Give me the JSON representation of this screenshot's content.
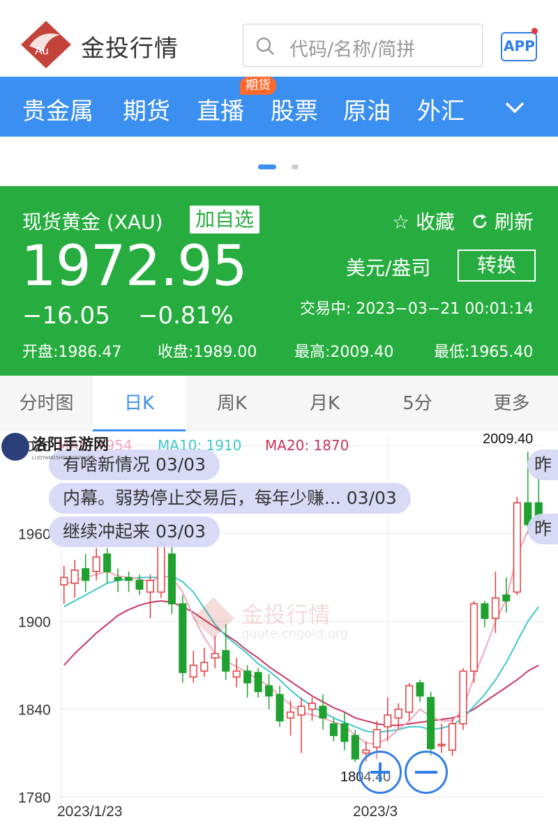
{
  "header": {
    "brand": "金投行情",
    "logo_text": "Au",
    "search_placeholder": "代码/名称/简拼",
    "app_label": "APP"
  },
  "nav": {
    "items": [
      "贵金属",
      "期货",
      "直播",
      "股票",
      "原油",
      "外汇"
    ],
    "badge": "期货"
  },
  "quote": {
    "name": "现货黄金 (XAU)",
    "add_label": "加自选",
    "fav_label": "☆ 收藏",
    "refresh_label": "刷新",
    "price": "1972.95",
    "unit": "美元/盎司",
    "convert_label": "转换",
    "change": "−16.05",
    "change_pct": "−0.81%",
    "status_time": "交易中:  2023−03−21 00:01:14",
    "open": "开盘:1986.47",
    "prev_close": "收盘:1989.00",
    "high": "最高:2009.40",
    "low": "最低:1965.40",
    "color": "#27ad3f"
  },
  "tabs": [
    {
      "label": "分时图",
      "active": false
    },
    {
      "label": "日K",
      "active": true
    },
    {
      "label": "周K",
      "active": false
    },
    {
      "label": "月K",
      "active": false
    },
    {
      "label": "5分",
      "active": false
    },
    {
      "label": "更多",
      "active": false
    }
  ],
  "chart": {
    "ma5_label": "MA5: 1954",
    "ma10_label": "MA10: 1910",
    "ma20_label": "MA20: 1870",
    "news": [
      "有啥新情况 03/03",
      "内幕。弱势停止交易后，每年少赚... 03/03",
      "继续冲起来 03/03"
    ],
    "news_right": [
      "昨",
      "昨"
    ],
    "high_marker": "2009.40",
    "low_marker": "1804.40",
    "watermark": "金投行情",
    "watermark_url": "quote.cngold.org",
    "site_logo": "洛阳手游网",
    "site_logo_sub": "LUOYANGSHOUYOUWANG"
  },
  "chart_data": {
    "type": "candlestick",
    "ylim": [
      1775,
      2025
    ],
    "yticks": [
      "2020",
      "1960",
      "1900",
      "1840",
      "1780"
    ],
    "xlabels": [
      "2023/1/23",
      "2023/3"
    ],
    "colors": {
      "up": "#e4393c",
      "down": "#1fa12f",
      "ma5": "#f2a6bd",
      "ma10": "#3ec7cc",
      "ma20": "#c7375f"
    },
    "candles": [
      {
        "o": 1925,
        "c": 1930,
        "h": 1938,
        "l": 1912
      },
      {
        "o": 1926,
        "c": 1935,
        "h": 1942,
        "l": 1916
      },
      {
        "o": 1936,
        "c": 1928,
        "h": 1946,
        "l": 1920
      },
      {
        "o": 1934,
        "c": 1944,
        "h": 1950,
        "l": 1928
      },
      {
        "o": 1946,
        "c": 1934,
        "h": 1950,
        "l": 1926
      },
      {
        "o": 1930,
        "c": 1928,
        "h": 1936,
        "l": 1920
      },
      {
        "o": 1930,
        "c": 1928,
        "h": 1934,
        "l": 1920
      },
      {
        "o": 1928,
        "c": 1922,
        "h": 1932,
        "l": 1918
      },
      {
        "o": 1920,
        "c": 1928,
        "h": 1932,
        "l": 1902
      },
      {
        "o": 1920,
        "c": 1953,
        "h": 1956,
        "l": 1916
      },
      {
        "o": 1946,
        "c": 1912,
        "h": 1960,
        "l": 1905
      },
      {
        "o": 1912,
        "c": 1865,
        "h": 1918,
        "l": 1858
      },
      {
        "o": 1862,
        "c": 1870,
        "h": 1880,
        "l": 1858
      },
      {
        "o": 1866,
        "c": 1872,
        "h": 1882,
        "l": 1862
      },
      {
        "o": 1875,
        "c": 1878,
        "h": 1890,
        "l": 1868
      },
      {
        "o": 1880,
        "c": 1866,
        "h": 1898,
        "l": 1860
      },
      {
        "o": 1862,
        "c": 1866,
        "h": 1875,
        "l": 1855
      },
      {
        "o": 1866,
        "c": 1858,
        "h": 1870,
        "l": 1848
      },
      {
        "o": 1865,
        "c": 1852,
        "h": 1868,
        "l": 1848
      },
      {
        "o": 1856,
        "c": 1849,
        "h": 1864,
        "l": 1840
      },
      {
        "o": 1850,
        "c": 1832,
        "h": 1856,
        "l": 1828
      },
      {
        "o": 1834,
        "c": 1838,
        "h": 1846,
        "l": 1822
      },
      {
        "o": 1836,
        "c": 1842,
        "h": 1848,
        "l": 1810
      },
      {
        "o": 1840,
        "c": 1844,
        "h": 1848,
        "l": 1832
      },
      {
        "o": 1842,
        "c": 1834,
        "h": 1850,
        "l": 1826
      },
      {
        "o": 1830,
        "c": 1822,
        "h": 1834,
        "l": 1818
      },
      {
        "o": 1830,
        "c": 1818,
        "h": 1838,
        "l": 1812
      },
      {
        "o": 1822,
        "c": 1806,
        "h": 1826,
        "l": 1804
      },
      {
        "o": 1810,
        "c": 1812,
        "h": 1818,
        "l": 1804
      },
      {
        "o": 1814,
        "c": 1826,
        "h": 1832,
        "l": 1806
      },
      {
        "o": 1828,
        "c": 1836,
        "h": 1848,
        "l": 1818
      },
      {
        "o": 1834,
        "c": 1840,
        "h": 1844,
        "l": 1826
      },
      {
        "o": 1838,
        "c": 1856,
        "h": 1858,
        "l": 1832
      },
      {
        "o": 1858,
        "c": 1849,
        "h": 1860,
        "l": 1845
      },
      {
        "o": 1848,
        "c": 1813,
        "h": 1852,
        "l": 1808
      },
      {
        "o": 1816,
        "c": 1816,
        "h": 1830,
        "l": 1810
      },
      {
        "o": 1812,
        "c": 1830,
        "h": 1834,
        "l": 1808
      },
      {
        "o": 1830,
        "c": 1866,
        "h": 1868,
        "l": 1826
      },
      {
        "o": 1866,
        "c": 1912,
        "h": 1914,
        "l": 1858
      },
      {
        "o": 1912,
        "c": 1902,
        "h": 1914,
        "l": 1896
      },
      {
        "o": 1902,
        "c": 1916,
        "h": 1934,
        "l": 1892
      },
      {
        "o": 1918,
        "c": 1914,
        "h": 1930,
        "l": 1906
      },
      {
        "o": 1920,
        "c": 1981,
        "h": 1985,
        "l": 1918
      },
      {
        "o": 1981,
        "c": 1966,
        "h": 2016,
        "l": 1960
      },
      {
        "o": 1981,
        "c": 1968,
        "h": 2009.4,
        "l": 1965.4
      }
    ],
    "ma5": [
      1925,
      1928,
      1930,
      1932,
      1934,
      1931,
      1930,
      1929,
      1927,
      1931,
      1930,
      1920,
      1903,
      1889,
      1878,
      1873,
      1869,
      1865,
      1860,
      1856,
      1849,
      1843,
      1838,
      1836,
      1834,
      1831,
      1829,
      1822,
      1817,
      1816,
      1820,
      1826,
      1832,
      1840,
      1835,
      1832,
      1832,
      1840,
      1862,
      1880,
      1900,
      1915,
      1945,
      1962,
      1972
    ],
    "ma10": [
      1910,
      1914,
      1918,
      1922,
      1926,
      1928,
      1929,
      1930,
      1930,
      1930,
      1931,
      1927,
      1920,
      1909,
      1898,
      1890,
      1884,
      1878,
      1871,
      1866,
      1860,
      1853,
      1847,
      1842,
      1838,
      1834,
      1831,
      1828,
      1825,
      1824,
      1825,
      1826,
      1828,
      1828,
      1826,
      1827,
      1829,
      1834,
      1842,
      1850,
      1860,
      1872,
      1886,
      1900,
      1910
    ],
    "ma20": [
      1870,
      1878,
      1885,
      1892,
      1898,
      1904,
      1908,
      1911,
      1913,
      1914,
      1913,
      1910,
      1906,
      1901,
      1896,
      1891,
      1886,
      1880,
      1875,
      1869,
      1864,
      1859,
      1854,
      1849,
      1845,
      1841,
      1838,
      1834,
      1832,
      1830,
      1829,
      1829,
      1830,
      1831,
      1832,
      1833,
      1834,
      1836,
      1840,
      1845,
      1850,
      1855,
      1860,
      1866,
      1870
    ]
  }
}
